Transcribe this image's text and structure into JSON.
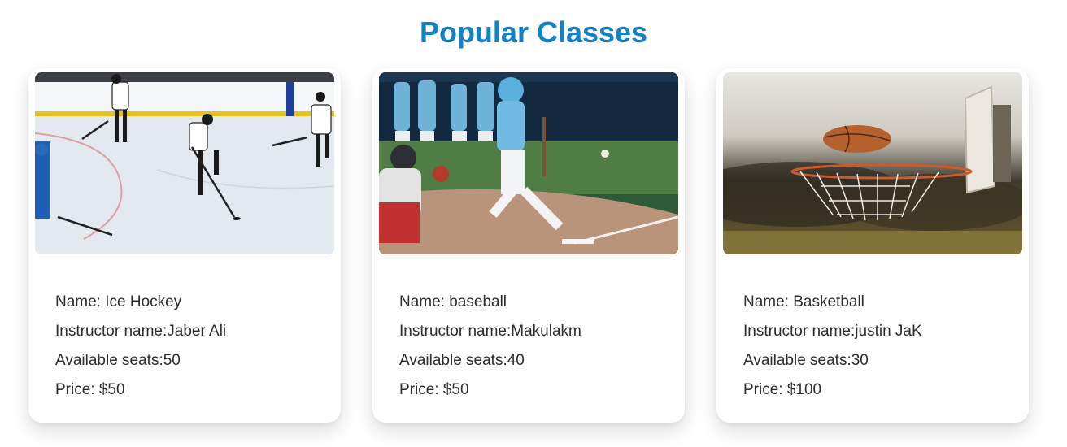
{
  "page": {
    "title": "Popular Classes"
  },
  "colors": {
    "title": "#1282c4",
    "text": "#2b2b2b"
  },
  "classes": [
    {
      "image_icon": "ice-hockey-photo",
      "name_line": "Name: Ice Hockey",
      "instructor_line": "Instructor name:Jaber Ali",
      "seats_line": "Available seats:50",
      "price_line": "Price: $50"
    },
    {
      "image_icon": "baseball-photo",
      "name_line": "Name: baseball",
      "instructor_line": "Instructor name:Makulakm",
      "seats_line": "Available seats:40",
      "price_line": "Price: $50"
    },
    {
      "image_icon": "basketball-photo",
      "name_line": "Name: Basketball",
      "instructor_line": "Instructor name:justin JaK",
      "seats_line": "Available seats:30",
      "price_line": "Price: $100"
    }
  ]
}
